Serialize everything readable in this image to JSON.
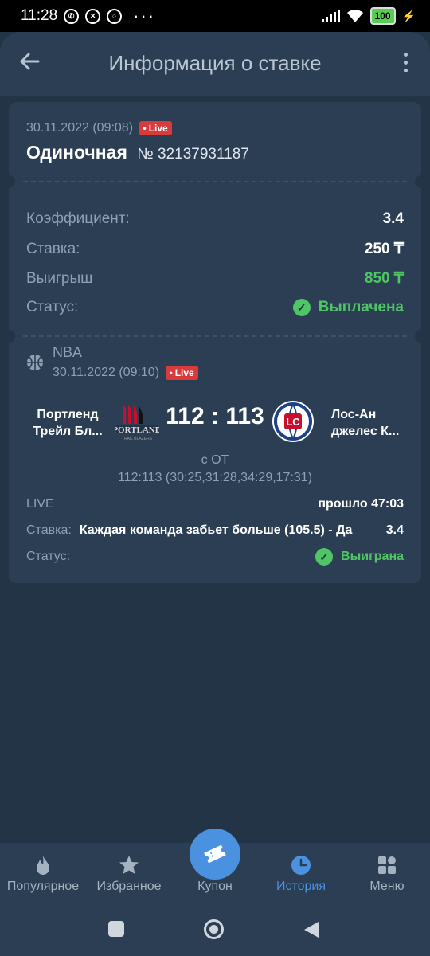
{
  "status_bar": {
    "time": "11:28",
    "battery": "100"
  },
  "header": {
    "title": "Информация о ставке"
  },
  "bet": {
    "datetime": "30.11.2022 (09:08)",
    "live_badge": "Live",
    "type": "Одиночная",
    "number": "№ 32137931187",
    "summary": [
      {
        "label": "Коэффициент:",
        "value": "3.4"
      },
      {
        "label": "Ставка:",
        "value": "250 ₸"
      },
      {
        "label": "Выигрыш",
        "value": "850 ₸"
      },
      {
        "label": "Статус:",
        "value": "Выплачена"
      }
    ]
  },
  "event": {
    "league": "NBA",
    "datetime": "30.11.2022 (09:10)",
    "live_badge": "Live",
    "home_team_line1": "Портленд",
    "home_team_line2": "Трейл Бл...",
    "away_team_line1": "Лос-Ан",
    "away_team_line2": "джелес К...",
    "score": "112 : 113",
    "score_note": "с ОТ",
    "period_scores": "112:113 (30:25,31:28,34:29,17:31)",
    "state_label": "LIVE",
    "elapsed": "прошло 47:03",
    "stake_label": "Ставка:",
    "stake_text": "Каждая команда забьет больше (105.5) - Да",
    "stake_odds": "3.4",
    "status_label": "Статус:",
    "status_value": "Выиграна"
  },
  "bottom_nav": [
    {
      "label": "Популярное",
      "icon": "fire-icon"
    },
    {
      "label": "Избранное",
      "icon": "star-icon"
    },
    {
      "label": "Купон",
      "icon": "ticket-icon"
    },
    {
      "label": "История",
      "icon": "clock-icon"
    },
    {
      "label": "Меню",
      "icon": "grid-icon"
    }
  ],
  "colors": {
    "background": "#243447",
    "card": "#2c3e53",
    "accent": "#4a92e0",
    "success": "#4fc565",
    "live": "#d83b3b"
  }
}
